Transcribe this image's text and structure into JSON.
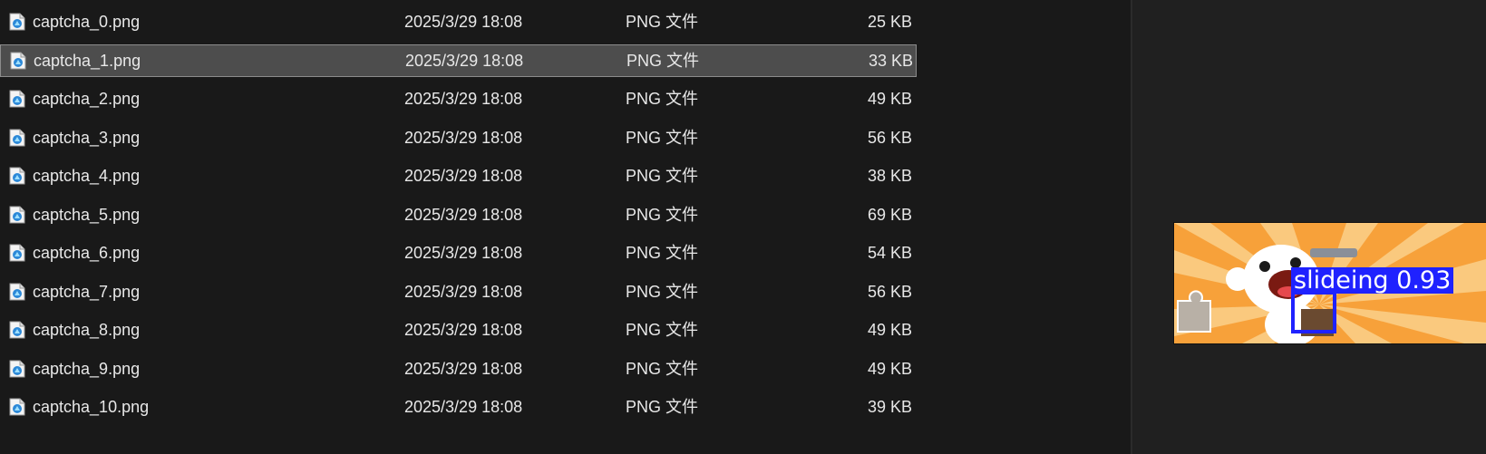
{
  "file_list": {
    "selected_index": 1,
    "icon": "png-image-file-icon",
    "rows": [
      {
        "name": "captcha_0.png",
        "date": "2025/3/29 18:08",
        "type": "PNG 文件",
        "size": "25 KB"
      },
      {
        "name": "captcha_1.png",
        "date": "2025/3/29 18:08",
        "type": "PNG 文件",
        "size": "33 KB"
      },
      {
        "name": "captcha_2.png",
        "date": "2025/3/29 18:08",
        "type": "PNG 文件",
        "size": "49 KB"
      },
      {
        "name": "captcha_3.png",
        "date": "2025/3/29 18:08",
        "type": "PNG 文件",
        "size": "56 KB"
      },
      {
        "name": "captcha_4.png",
        "date": "2025/3/29 18:08",
        "type": "PNG 文件",
        "size": "38 KB"
      },
      {
        "name": "captcha_5.png",
        "date": "2025/3/29 18:08",
        "type": "PNG 文件",
        "size": "69 KB"
      },
      {
        "name": "captcha_6.png",
        "date": "2025/3/29 18:08",
        "type": "PNG 文件",
        "size": "54 KB"
      },
      {
        "name": "captcha_7.png",
        "date": "2025/3/29 18:08",
        "type": "PNG 文件",
        "size": "56 KB"
      },
      {
        "name": "captcha_8.png",
        "date": "2025/3/29 18:08",
        "type": "PNG 文件",
        "size": "49 KB"
      },
      {
        "name": "captcha_9.png",
        "date": "2025/3/29 18:08",
        "type": "PNG 文件",
        "size": "49 KB"
      },
      {
        "name": "captcha_10.png",
        "date": "2025/3/29 18:08",
        "type": "PNG 文件",
        "size": "39 KB"
      }
    ]
  },
  "preview": {
    "detection_label": "slideing 0.93",
    "box_color": "#1f22ff",
    "background_color": "#f7a13a",
    "icon": "captcha-preview-image"
  }
}
